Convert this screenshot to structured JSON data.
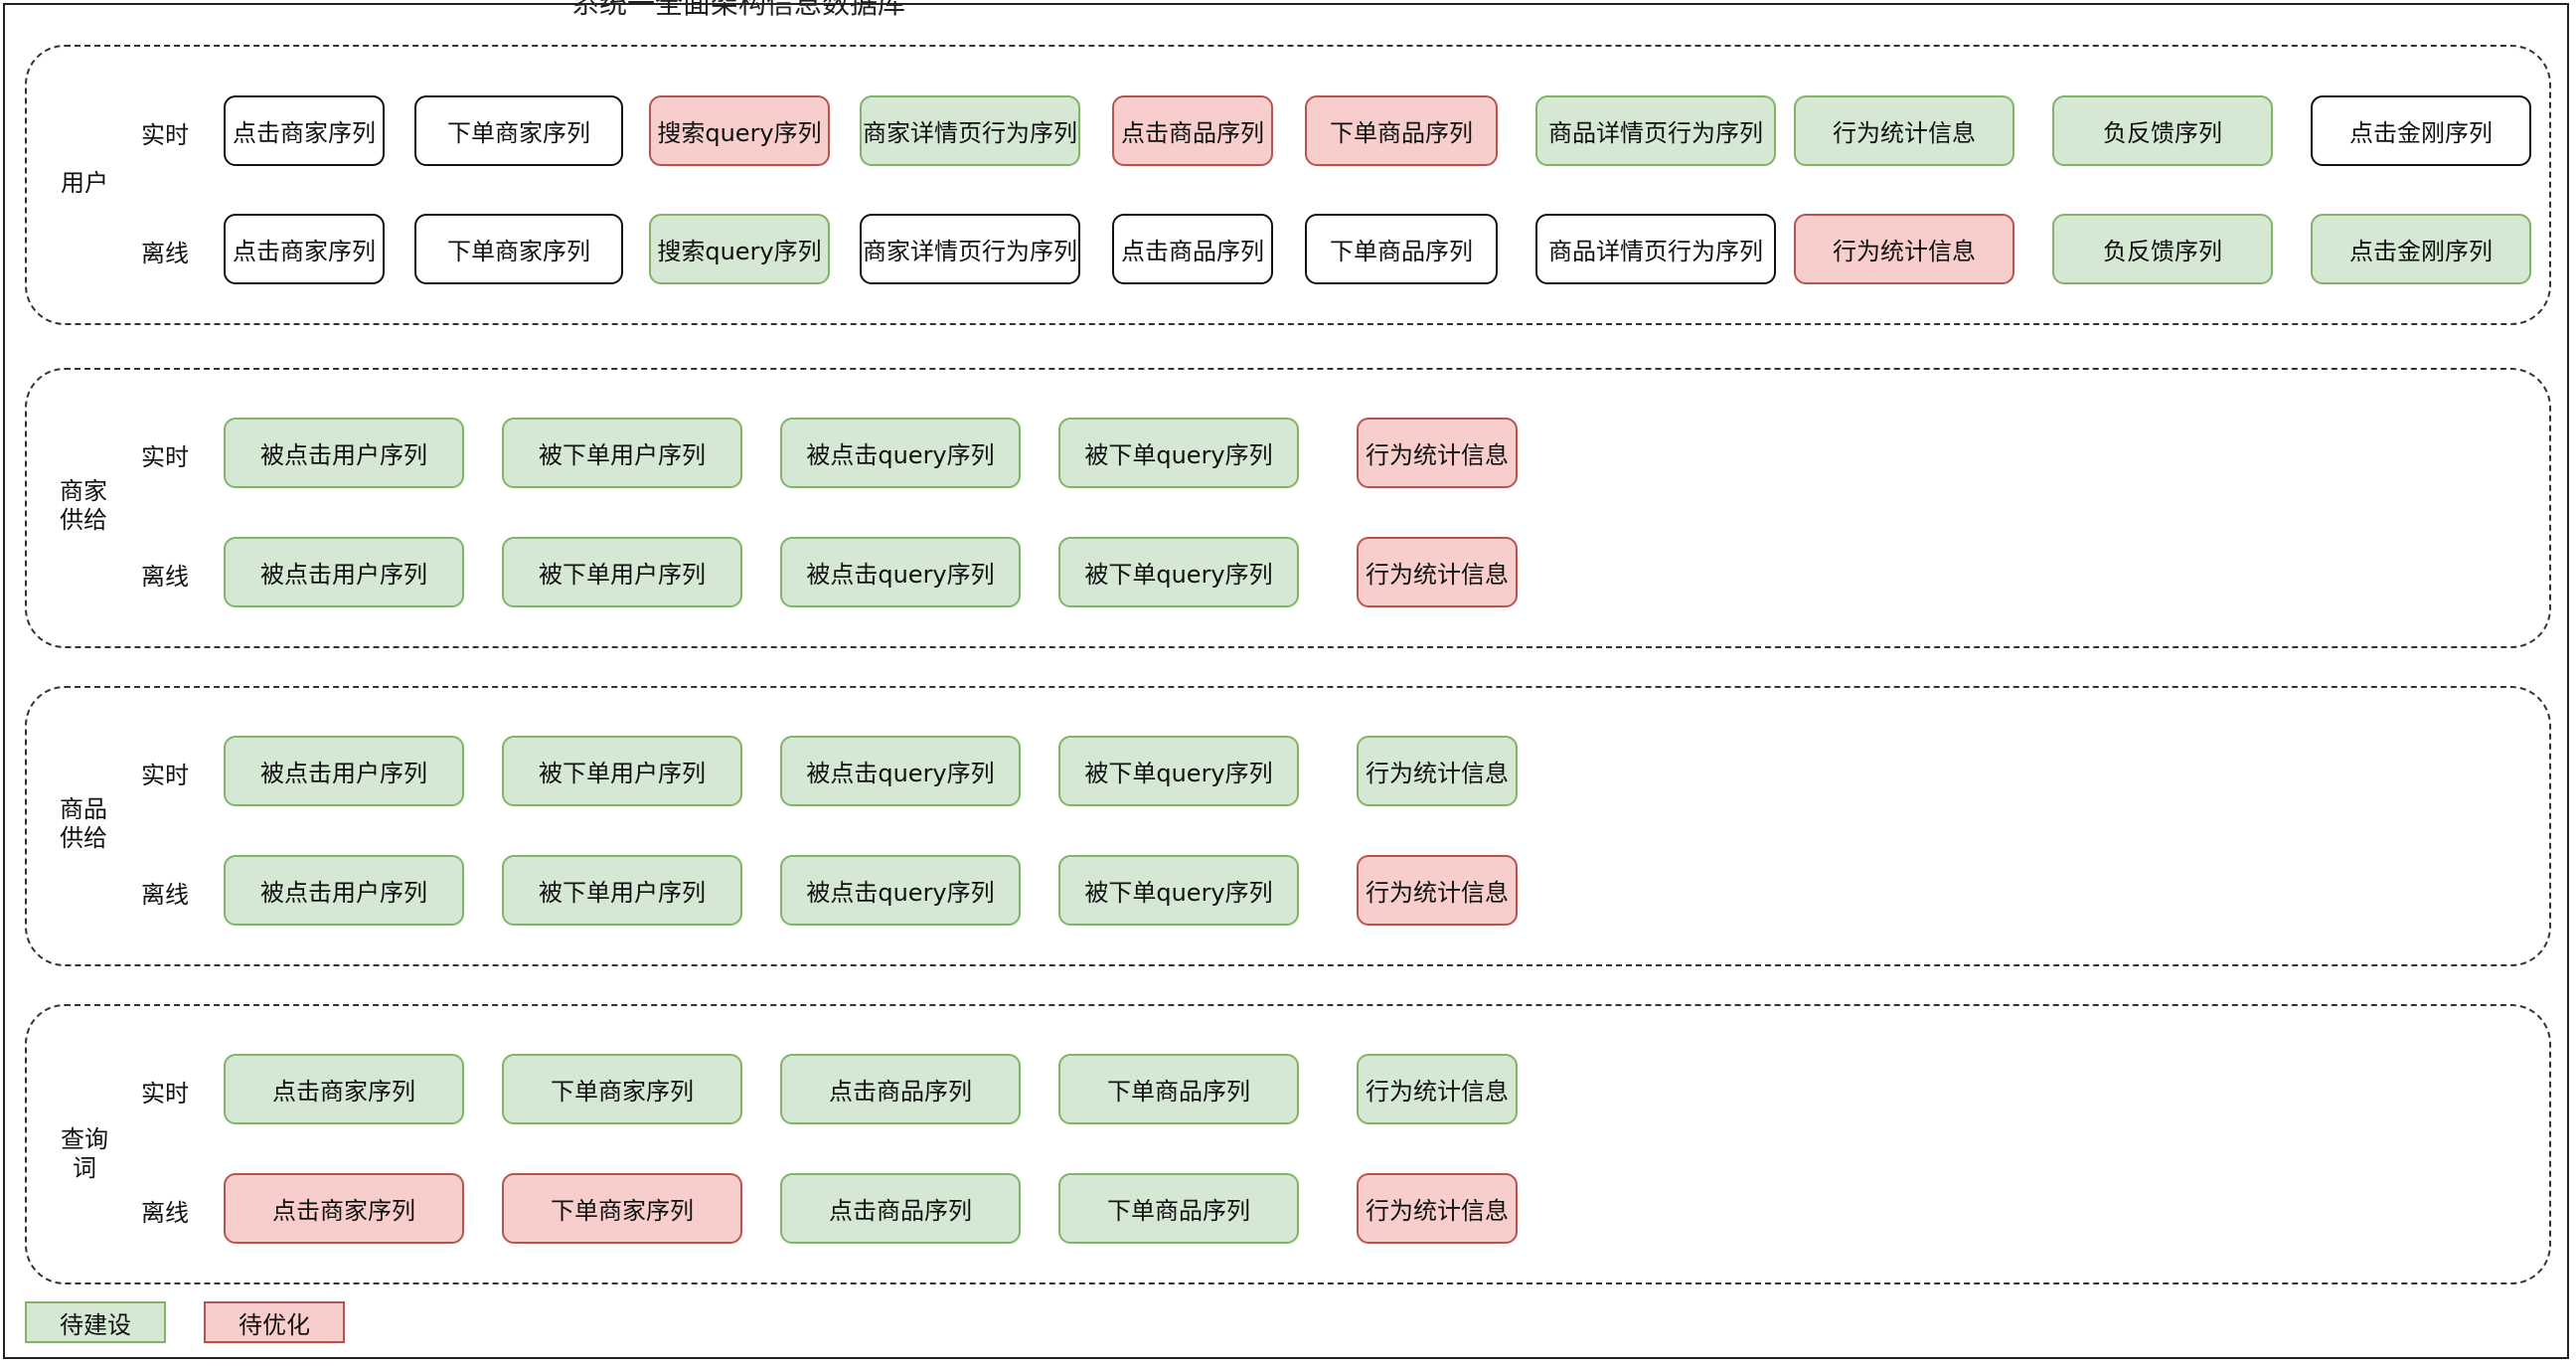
{
  "title_fragment": "系统一全面架构信息数据库",
  "groups": [
    {
      "label": "用户",
      "realtime_label": "实时",
      "offline_label": "离线",
      "realtime": [
        {
          "text": "点击商家序列",
          "status": "none"
        },
        {
          "text": "下单商家序列",
          "status": "none"
        },
        {
          "text": "搜索query序列",
          "status": "red"
        },
        {
          "text": "商家详情页行为序列",
          "status": "green"
        },
        {
          "text": "点击商品序列",
          "status": "red"
        },
        {
          "text": "下单商品序列",
          "status": "red"
        },
        {
          "text": "商品详情页行为序列",
          "status": "green"
        },
        {
          "text": "行为统计信息",
          "status": "green"
        },
        {
          "text": "负反馈序列",
          "status": "green"
        },
        {
          "text": "点击金刚序列",
          "status": "none"
        }
      ],
      "offline": [
        {
          "text": "点击商家序列",
          "status": "none"
        },
        {
          "text": "下单商家序列",
          "status": "none"
        },
        {
          "text": "搜索query序列",
          "status": "green"
        },
        {
          "text": "商家详情页行为序列",
          "status": "none"
        },
        {
          "text": "点击商品序列",
          "status": "none"
        },
        {
          "text": "下单商品序列",
          "status": "none"
        },
        {
          "text": "商品详情页行为序列",
          "status": "none"
        },
        {
          "text": "行为统计信息",
          "status": "red"
        },
        {
          "text": "负反馈序列",
          "status": "green"
        },
        {
          "text": "点击金刚序列",
          "status": "green"
        }
      ]
    },
    {
      "label": "商家供给",
      "realtime_label": "实时",
      "offline_label": "离线",
      "realtime": [
        {
          "text": "被点击用户序列",
          "status": "green"
        },
        {
          "text": "被下单用户序列",
          "status": "green"
        },
        {
          "text": "被点击query序列",
          "status": "green"
        },
        {
          "text": "被下单query序列",
          "status": "green"
        },
        {
          "text": "行为统计信息",
          "status": "red"
        }
      ],
      "offline": [
        {
          "text": "被点击用户序列",
          "status": "green"
        },
        {
          "text": "被下单用户序列",
          "status": "green"
        },
        {
          "text": "被点击query序列",
          "status": "green"
        },
        {
          "text": "被下单query序列",
          "status": "green"
        },
        {
          "text": "行为统计信息",
          "status": "red"
        }
      ]
    },
    {
      "label": "商品供给",
      "realtime_label": "实时",
      "offline_label": "离线",
      "realtime": [
        {
          "text": "被点击用户序列",
          "status": "green"
        },
        {
          "text": "被下单用户序列",
          "status": "green"
        },
        {
          "text": "被点击query序列",
          "status": "green"
        },
        {
          "text": "被下单query序列",
          "status": "green"
        },
        {
          "text": "行为统计信息",
          "status": "green"
        }
      ],
      "offline": [
        {
          "text": "被点击用户序列",
          "status": "green"
        },
        {
          "text": "被下单用户序列",
          "status": "green"
        },
        {
          "text": "被点击query序列",
          "status": "green"
        },
        {
          "text": "被下单query序列",
          "status": "green"
        },
        {
          "text": "行为统计信息",
          "status": "red"
        }
      ]
    },
    {
      "label": "查询词",
      "realtime_label": "实时",
      "offline_label": "离线",
      "realtime": [
        {
          "text": "点击商家序列",
          "status": "green"
        },
        {
          "text": "下单商家序列",
          "status": "green"
        },
        {
          "text": "点击商品序列",
          "status": "green"
        },
        {
          "text": "下单商品序列",
          "status": "green"
        },
        {
          "text": "行为统计信息",
          "status": "green"
        }
      ],
      "offline": [
        {
          "text": "点击商家序列",
          "status": "red"
        },
        {
          "text": "下单商家序列",
          "status": "red"
        },
        {
          "text": "点击商品序列",
          "status": "green"
        },
        {
          "text": "下单商品序列",
          "status": "green"
        },
        {
          "text": "行为统计信息",
          "status": "red"
        }
      ]
    }
  ],
  "legend": [
    {
      "text": "待建设",
      "status": "green"
    },
    {
      "text": "待优化",
      "status": "red"
    }
  ],
  "colors": {
    "green_fill": "#d5e8d4",
    "green_border": "#82b366",
    "red_fill": "#f8cecc",
    "red_border": "#b85450"
  }
}
